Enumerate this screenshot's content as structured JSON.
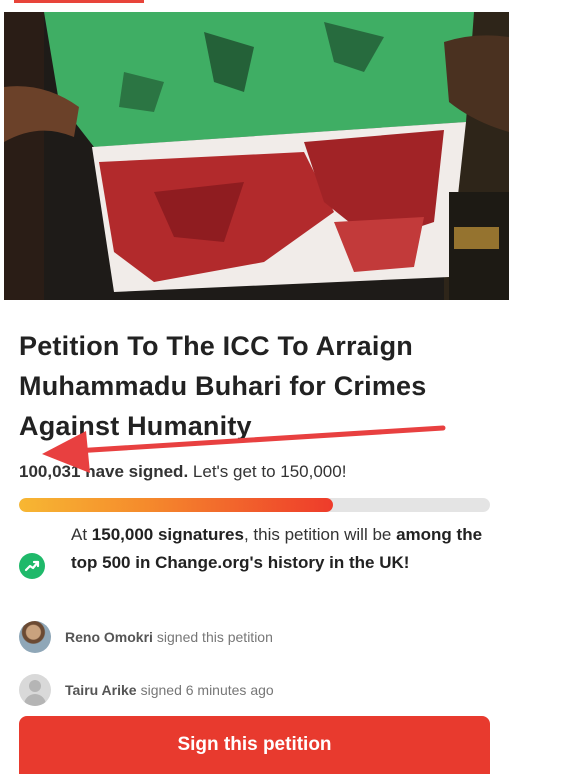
{
  "petition": {
    "title": "Petition To The ICC To Arraign Muhammadu Buhari for Crimes Against Humanity",
    "signed_count": "100,031",
    "signed_suffix": "have signed.",
    "goal_text": "Let's get to 150,000!",
    "progress_fraction": 0.6669
  },
  "milestone": {
    "prefix": "At",
    "target": "150,000 signatures",
    "middle": ", this petition will be",
    "highlight": "among the top 500 in Change.org's history in the UK!",
    "icon": "trending-up-icon"
  },
  "signers": [
    {
      "name": "Reno Omokri",
      "action": "signed this petition",
      "avatar": "photo"
    },
    {
      "name": "Tairu Arike",
      "action": "signed 6 minutes ago",
      "avatar": "default"
    }
  ],
  "cta": {
    "label": "Sign this petition"
  },
  "colors": {
    "accent": "#e83a2e",
    "progress_start": "#f7b733",
    "progress_end": "#ee3b2b",
    "milestone_icon": "#1fb96a",
    "annotation_arrow": "#e84040"
  }
}
